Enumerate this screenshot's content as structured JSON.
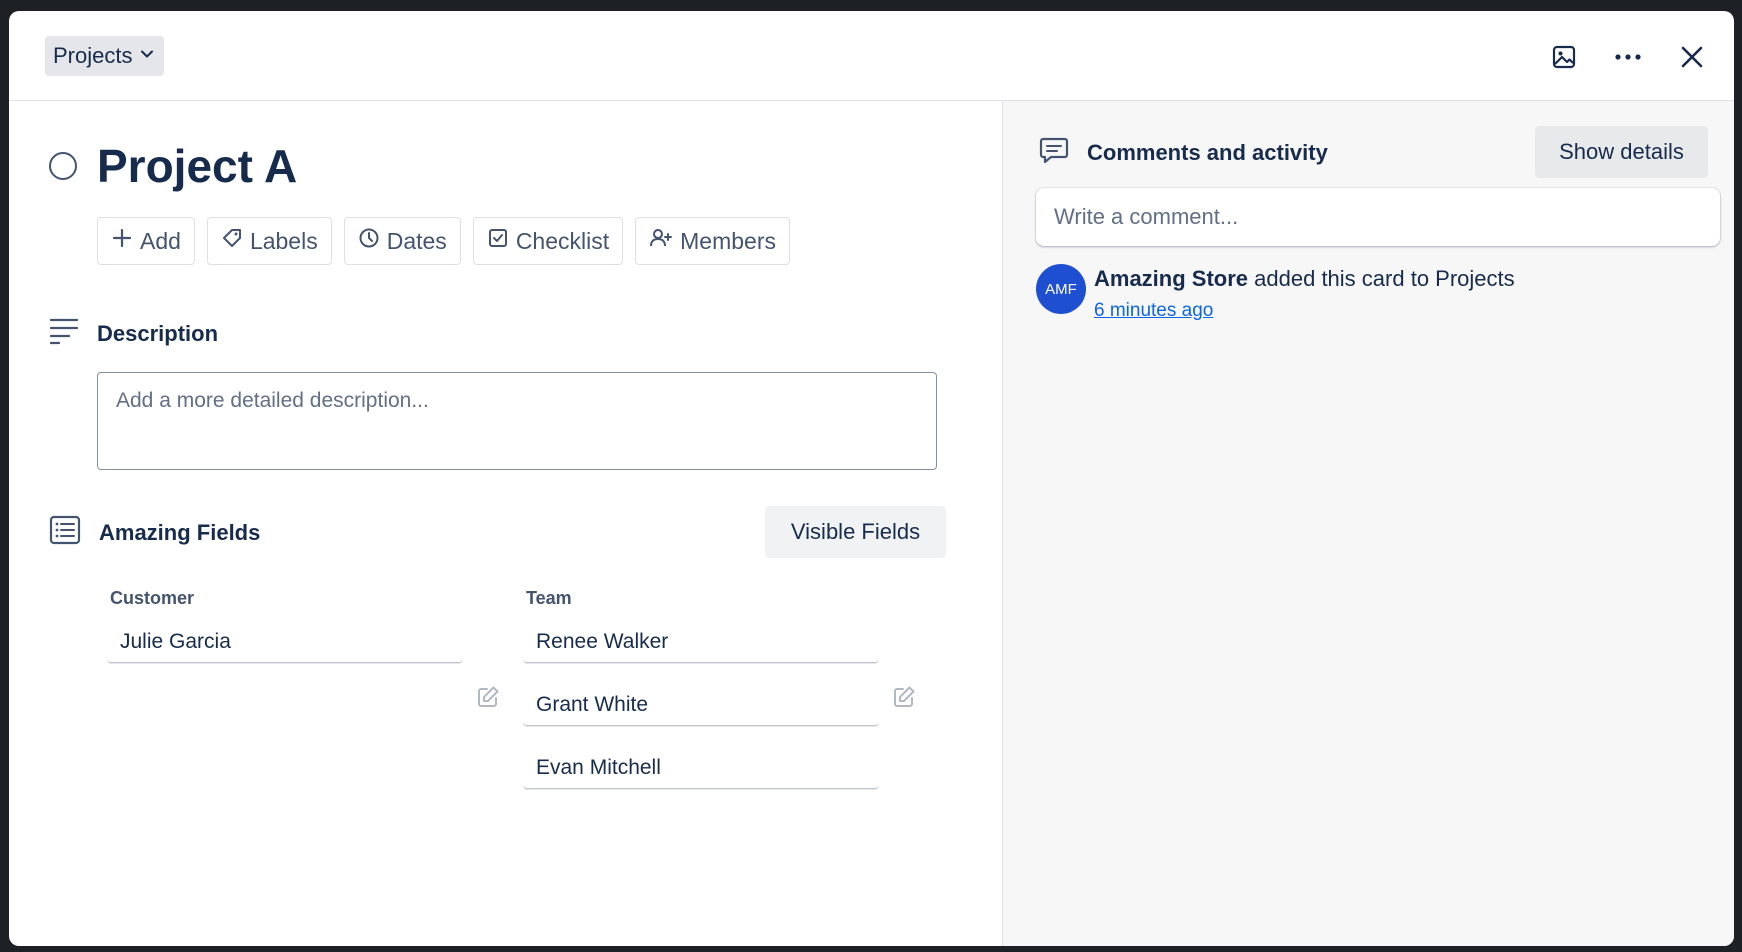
{
  "header": {
    "list_name": "Projects"
  },
  "card": {
    "title": "Project A"
  },
  "actions": {
    "add": "Add",
    "labels": "Labels",
    "dates": "Dates",
    "checklist": "Checklist",
    "members": "Members"
  },
  "description": {
    "title": "Description",
    "placeholder": "Add a more detailed description..."
  },
  "fields": {
    "title": "Amazing Fields",
    "visible_fields_label": "Visible Fields",
    "customer": {
      "label": "Customer",
      "values": [
        "Julie Garcia"
      ]
    },
    "team": {
      "label": "Team",
      "values": [
        "Renee Walker",
        "Grant White",
        "Evan Mitchell"
      ]
    }
  },
  "sidebar": {
    "title": "Comments and activity",
    "show_details_label": "Show details",
    "comment_placeholder": "Write a comment...",
    "activity": [
      {
        "avatar_initials": "AMF",
        "user": "Amazing Store",
        "action": "added this card to Projects",
        "time": "6 minutes ago"
      }
    ]
  },
  "colors": {
    "avatar": "#1f4fd1",
    "link": "#0c66e4",
    "background": "#1d2125"
  },
  "icons": [
    "chevron-down-icon",
    "cover-image-icon",
    "more-icon",
    "close-icon",
    "plus-icon",
    "tag-icon",
    "clock-icon",
    "checkbox-icon",
    "add-member-icon",
    "description-icon",
    "fields-icon",
    "edit-icon",
    "comment-icon"
  ]
}
